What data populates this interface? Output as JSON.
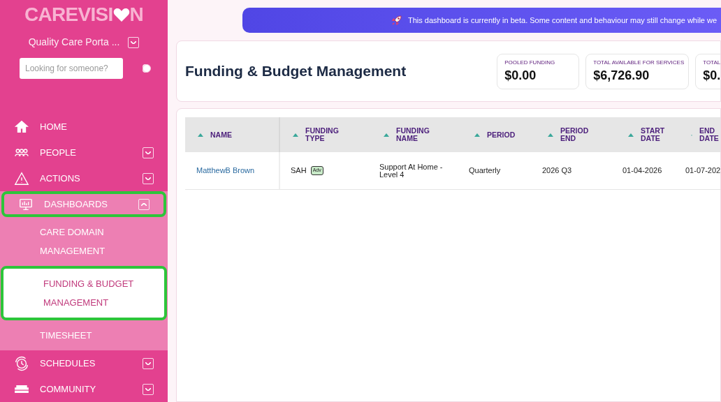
{
  "sidebar": {
    "logo": {
      "text_before": "CAREVISI",
      "text_after": "N"
    },
    "org_selector": {
      "label": "Quality Care Porta ..."
    },
    "search": {
      "placeholder": "Looking for someone?"
    },
    "toggle": {
      "on": false
    },
    "nav": [
      {
        "label": "HOME",
        "kind": "home",
        "expandable": false,
        "expanded": false,
        "highlighted": false
      },
      {
        "label": "PEOPLE",
        "kind": "people",
        "expandable": true,
        "expanded": false,
        "highlighted": false
      },
      {
        "label": "ACTIONS",
        "kind": "warning",
        "expandable": true,
        "expanded": false,
        "highlighted": false
      },
      {
        "label": "DASHBOARDS",
        "kind": "monitor",
        "expandable": true,
        "expanded": true,
        "highlighted": true,
        "children": [
          {
            "label": "CARE DOMAIN MANAGEMENT",
            "selected": false,
            "highlighted": false
          },
          {
            "label": "FUNDING & BUDGET MANAGEMENT",
            "selected": true,
            "highlighted": true
          },
          {
            "label": "TIMESHEET",
            "selected": false,
            "highlighted": false
          }
        ]
      },
      {
        "label": "SCHEDULES",
        "kind": "clock",
        "expandable": true,
        "expanded": false,
        "highlighted": false
      },
      {
        "label": "COMMUNITY",
        "kind": "community",
        "expandable": true,
        "expanded": false,
        "highlighted": false
      }
    ]
  },
  "banner": {
    "text": "This dashboard is currently in beta. Some content and behaviour may still change while we"
  },
  "header": {
    "title": "Funding & Budget Management",
    "stats": [
      {
        "label": "POOLED FUNDING",
        "value": "$0.00"
      },
      {
        "label": "TOTAL AVAILABLE FOR SERVICES",
        "value": "$6,726.90"
      },
      {
        "label": "TOTAL",
        "value": "$0."
      }
    ]
  },
  "table": {
    "columns": [
      "NAME",
      "FUNDING TYPE",
      "FUNDING NAME",
      "PERIOD",
      "PERIOD END",
      "START DATE",
      "END DATE"
    ],
    "rows": [
      {
        "name": "MatthewB Brown",
        "funding_type": "SAH",
        "badge": "Adv",
        "funding_name": "Support At Home - Level 4",
        "period": "Quarterly",
        "period_end": "2026 Q3",
        "start_date": "01-04-2026",
        "end_date": "01-07-202"
      }
    ]
  }
}
